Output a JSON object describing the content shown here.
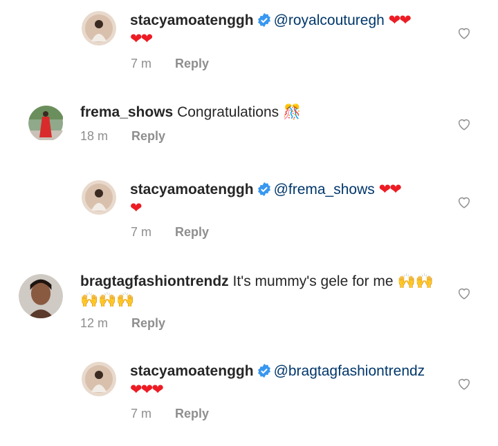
{
  "comments": [
    {
      "id": "reply-1",
      "indent": true,
      "username": "stacyamoatenggh",
      "verified": true,
      "mention": "@royalcouturegh",
      "text": "",
      "emoji": "❤❤",
      "emoji_line2": "❤❤",
      "time": "7 m",
      "reply_label": "Reply",
      "avatar_color": "#c9b7a8"
    },
    {
      "id": "comment-frema",
      "indent": false,
      "username": "frema_shows",
      "verified": false,
      "mention": "",
      "text": "Congratulations",
      "emoji": "🎊",
      "emoji_line2": "",
      "time": "18 m",
      "reply_label": "Reply",
      "avatar_color": "#d92b2b"
    },
    {
      "id": "reply-2",
      "indent": true,
      "username": "stacyamoatenggh",
      "verified": true,
      "mention": "@frema_shows",
      "text": "",
      "emoji": "❤❤",
      "emoji_line2": "❤",
      "time": "7 m",
      "reply_label": "Reply",
      "avatar_color": "#c9b7a8"
    },
    {
      "id": "comment-bragtag",
      "indent": false,
      "username": "bragtagfashiontrendz",
      "verified": false,
      "mention": "",
      "text": "It's mummy's gele for me",
      "emoji": "🙌🙌",
      "emoji_line2": "🙌🙌🙌",
      "time": "12 m",
      "reply_label": "Reply",
      "avatar_color": "#6b4a3a"
    },
    {
      "id": "reply-3",
      "indent": true,
      "username": "stacyamoatenggh",
      "verified": true,
      "mention": "@bragtagfashiontrendz",
      "text": "",
      "emoji": "",
      "emoji_line2": "❤❤❤",
      "time": "7 m",
      "reply_label": "Reply",
      "avatar_color": "#c9b7a8"
    }
  ],
  "colors": {
    "username": "#262626",
    "mention": "#00376b",
    "meta": "#8e8e8e",
    "verified": "#3897f0",
    "heart": "#ed1c24"
  },
  "icons": {
    "verified": "verified-badge-icon",
    "like": "heart-outline-icon"
  }
}
